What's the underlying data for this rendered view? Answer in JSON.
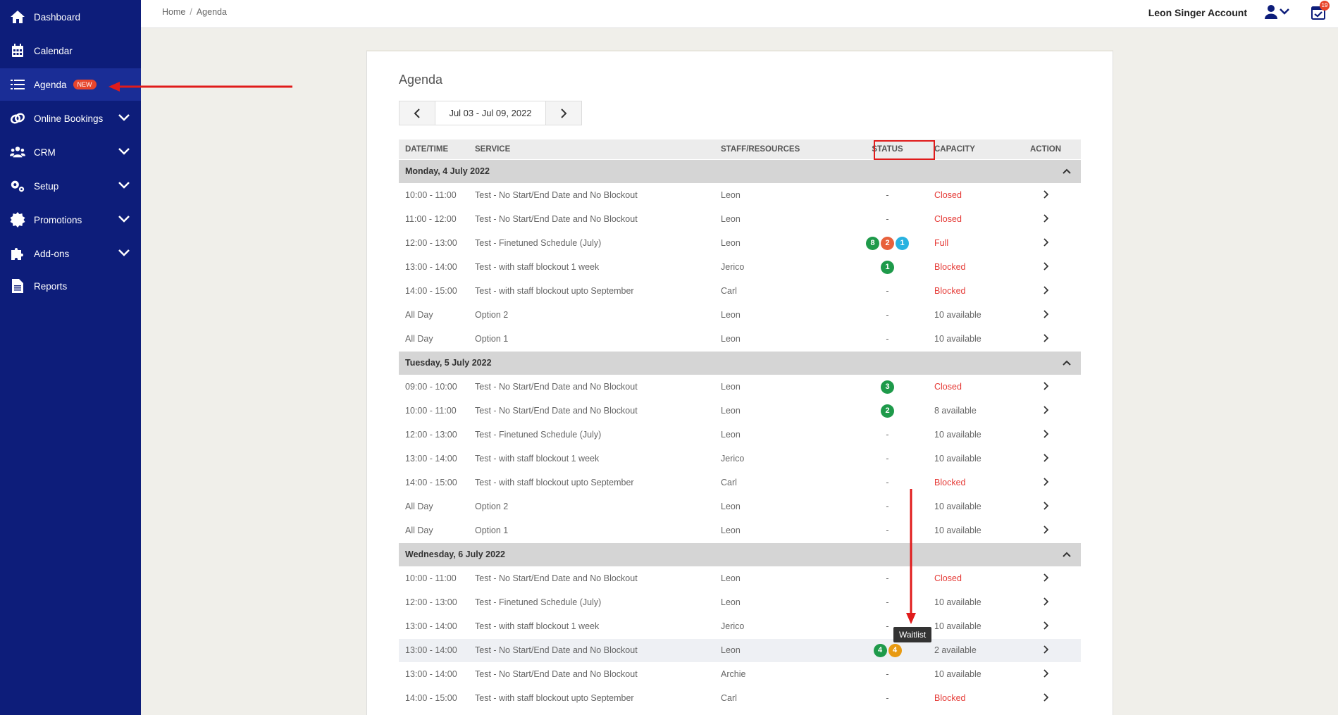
{
  "sidebar": {
    "items": [
      {
        "label": "Dashboard",
        "icon": "home-icon"
      },
      {
        "label": "Calendar",
        "icon": "calendar-icon"
      },
      {
        "label": "Agenda",
        "icon": "list-icon",
        "badge": "NEW"
      },
      {
        "label": "Online Bookings",
        "icon": "link-icon"
      },
      {
        "label": "CRM",
        "icon": "users-icon"
      },
      {
        "label": "Setup",
        "icon": "gears-icon"
      },
      {
        "label": "Promotions",
        "icon": "badge-icon"
      },
      {
        "label": "Add-ons",
        "icon": "puzzle-icon"
      },
      {
        "label": "Reports",
        "icon": "document-icon"
      }
    ]
  },
  "topbar": {
    "breadcrumb_home": "Home",
    "breadcrumb_separator": "/",
    "breadcrumb_current": "Agenda",
    "account_name": "Leon Singer Account",
    "notification_count": "19"
  },
  "main": {
    "title": "Agenda",
    "date_range": "Jul 03 - Jul 09, 2022",
    "columns": [
      "DATE/TIME",
      "SERVICE",
      "STAFF/RESOURCES",
      "STATUS",
      "CAPACITY",
      "ACTION"
    ],
    "tooltip": "Waitlist"
  },
  "colors": {
    "sidebar_bg": "#0d1d7a",
    "badge_green": "#1e9a4a",
    "badge_red": "#e8613c",
    "badge_blue": "#29b2e0",
    "badge_orange": "#e89a12",
    "status_red": "#e53935",
    "annotation_red": "#e01b1b"
  },
  "days": [
    {
      "label": "Monday, 4 July 2022",
      "rows": [
        {
          "time": "10:00 - 11:00",
          "service": "Test - No Start/End Date and No Blockout",
          "staff": "Leon",
          "status": "-",
          "capacity": "Closed"
        },
        {
          "time": "11:00 - 12:00",
          "service": "Test - No Start/End Date and No Blockout",
          "staff": "Leon",
          "status": "-",
          "capacity": "Closed"
        },
        {
          "time": "12:00 - 13:00",
          "service": "Test - Finetuned Schedule (July)",
          "staff": "Leon",
          "badges": [
            [
              "8",
              "green"
            ],
            [
              "2",
              "red"
            ],
            [
              "1",
              "blue"
            ]
          ],
          "capacity": "Full"
        },
        {
          "time": "13:00 - 14:00",
          "service": "Test - with staff blockout 1 week",
          "staff": "Jerico",
          "badges": [
            [
              "1",
              "green"
            ]
          ],
          "capacity": "Blocked"
        },
        {
          "time": "14:00 - 15:00",
          "service": "Test - with staff blockout upto September",
          "staff": "Carl",
          "status": "-",
          "capacity": "Blocked"
        },
        {
          "time": "All Day",
          "service": "Option 2",
          "staff": "Leon",
          "status": "-",
          "capacity": "10 available"
        },
        {
          "time": "All Day",
          "service": "Option 1",
          "staff": "Leon",
          "status": "-",
          "capacity": "10 available"
        }
      ]
    },
    {
      "label": "Tuesday, 5 July 2022",
      "rows": [
        {
          "time": "09:00 - 10:00",
          "service": "Test - No Start/End Date and No Blockout",
          "staff": "Leon",
          "badges": [
            [
              "3",
              "green"
            ]
          ],
          "capacity": "Closed"
        },
        {
          "time": "10:00 - 11:00",
          "service": "Test - No Start/End Date and No Blockout",
          "staff": "Leon",
          "badges": [
            [
              "2",
              "green"
            ]
          ],
          "capacity": "8 available"
        },
        {
          "time": "12:00 - 13:00",
          "service": "Test - Finetuned Schedule (July)",
          "staff": "Leon",
          "status": "-",
          "capacity": "10 available"
        },
        {
          "time": "13:00 - 14:00",
          "service": "Test - with staff blockout 1 week",
          "staff": "Jerico",
          "status": "-",
          "capacity": "10 available"
        },
        {
          "time": "14:00 - 15:00",
          "service": "Test - with staff blockout upto September",
          "staff": "Carl",
          "status": "-",
          "capacity": "Blocked"
        },
        {
          "time": "All Day",
          "service": "Option 2",
          "staff": "Leon",
          "status": "-",
          "capacity": "10 available"
        },
        {
          "time": "All Day",
          "service": "Option 1",
          "staff": "Leon",
          "status": "-",
          "capacity": "10 available"
        }
      ]
    },
    {
      "label": "Wednesday, 6 July 2022",
      "rows": [
        {
          "time": "10:00 - 11:00",
          "service": "Test - No Start/End Date and No Blockout",
          "staff": "Leon",
          "status": "-",
          "capacity": "Closed"
        },
        {
          "time": "12:00 - 13:00",
          "service": "Test - Finetuned Schedule (July)",
          "staff": "Leon",
          "status": "-",
          "capacity": "10 available"
        },
        {
          "time": "13:00 - 14:00",
          "service": "Test - with staff blockout 1 week",
          "staff": "Jerico",
          "status": "-",
          "capacity": "10 available"
        },
        {
          "time": "13:00 - 14:00",
          "service": "Test - No Start/End Date and No Blockout",
          "staff": "Leon",
          "badges": [
            [
              "4",
              "green"
            ],
            [
              "4",
              "orange"
            ]
          ],
          "capacity": "2 available",
          "highlight": true
        },
        {
          "time": "13:00 - 14:00",
          "service": "Test - No Start/End Date and No Blockout",
          "staff": "Archie",
          "status": "-",
          "capacity": "10 available"
        },
        {
          "time": "14:00 - 15:00",
          "service": "Test - with staff blockout upto September",
          "staff": "Carl",
          "status": "-",
          "capacity": "Blocked"
        }
      ]
    }
  ]
}
